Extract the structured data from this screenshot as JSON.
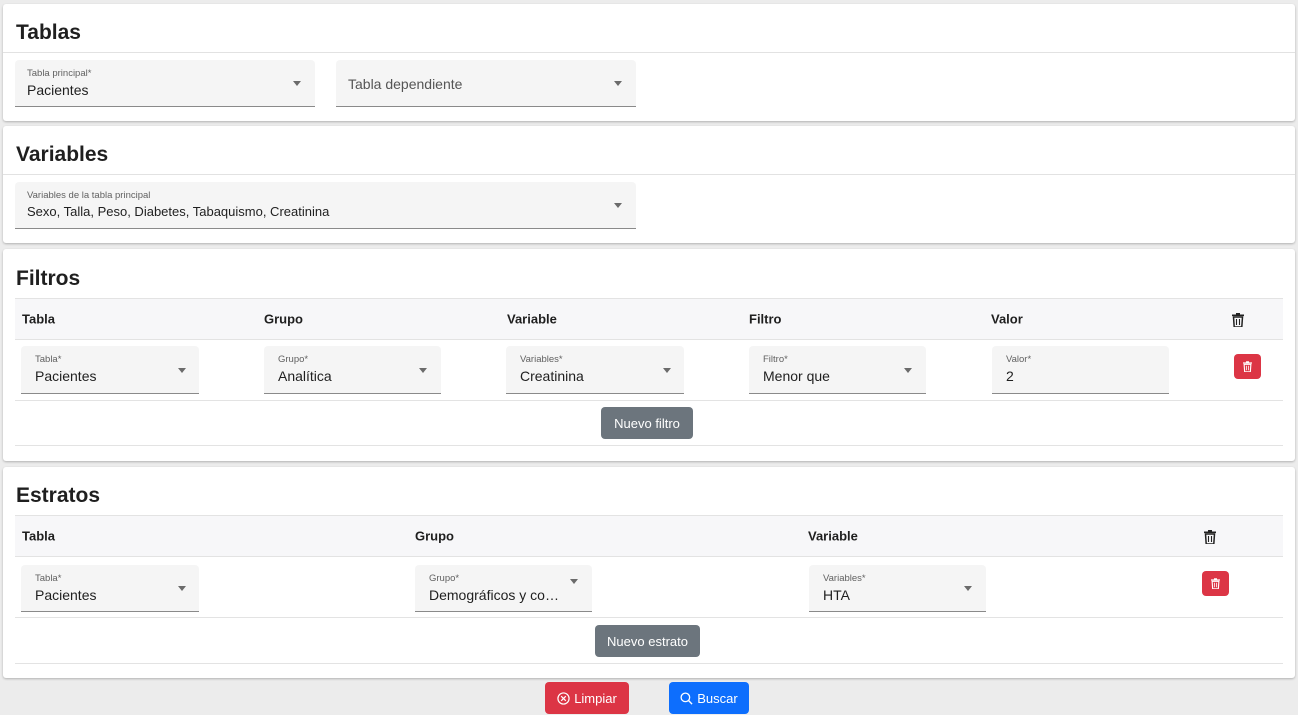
{
  "tablas": {
    "title": "Tablas",
    "principal_label": "Tabla principal*",
    "principal_value": "Pacientes",
    "dependiente_placeholder": "Tabla dependiente"
  },
  "variables": {
    "title": "Variables",
    "field_label": "Variables de la tabla principal",
    "field_value": "Sexo, Talla, Peso, Diabetes, Tabaquismo, Creatinina"
  },
  "filtros": {
    "title": "Filtros",
    "headers": [
      "Tabla",
      "Grupo",
      "Variable",
      "Filtro",
      "Valor"
    ],
    "row": {
      "tabla_label": "Tabla*",
      "tabla_value": "Pacientes",
      "grupo_label": "Grupo*",
      "grupo_value": "Analítica",
      "variable_label": "Variables*",
      "variable_value": "Creatinina",
      "filtro_label": "Filtro*",
      "filtro_value": "Menor que",
      "valor_label": "Valor*",
      "valor_value": "2"
    },
    "new_button": "Nuevo filtro"
  },
  "estratos": {
    "title": "Estratos",
    "headers": [
      "Tabla",
      "Grupo",
      "Variable"
    ],
    "row": {
      "tabla_label": "Tabla*",
      "tabla_value": "Pacientes",
      "grupo_label": "Grupo*",
      "grupo_value": "Demográficos y comorbilidades",
      "variable_label": "Variables*",
      "variable_value": "HTA"
    },
    "new_button": "Nuevo estrato"
  },
  "actions": {
    "clear_label": "Limpiar",
    "search_label": "Buscar"
  },
  "icons": {
    "trash": "trash-icon",
    "clear": "x-circle-icon",
    "search": "search-icon"
  },
  "colors": {
    "danger": "#dc3545",
    "primary": "#0d6efd",
    "secondary": "#6c757d"
  }
}
